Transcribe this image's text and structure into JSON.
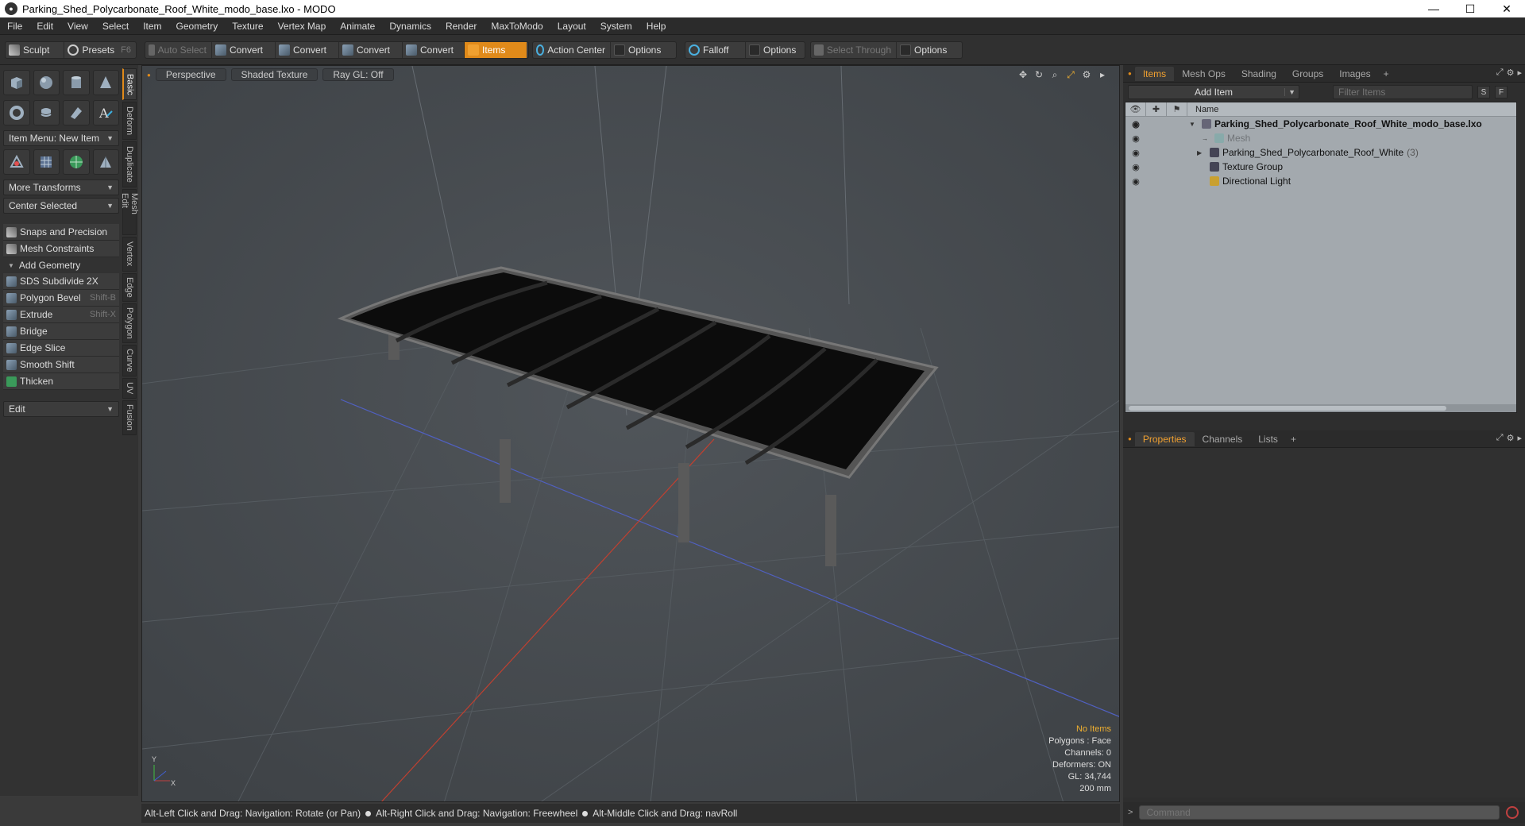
{
  "window": {
    "title": "Parking_Shed_Polycarbonate_Roof_White_modo_base.lxo - MODO",
    "minimize": "—",
    "maximize": "☐",
    "close": "✕"
  },
  "menu": [
    "File",
    "Edit",
    "View",
    "Select",
    "Item",
    "Geometry",
    "Texture",
    "Vertex Map",
    "Animate",
    "Dynamics",
    "Render",
    "MaxToModo",
    "Layout",
    "System",
    "Help"
  ],
  "toolbar": {
    "sculpt": "Sculpt",
    "presets": "Presets",
    "presets_shortcut": "F6",
    "auto_select": "Auto Select",
    "convert1": "Convert",
    "convert2": "Convert",
    "convert3": "Convert",
    "convert4": "Convert",
    "items": "Items",
    "action_center": "Action Center",
    "options1": "Options",
    "falloff": "Falloff",
    "options2": "Options",
    "select_through": "Select Through",
    "options3": "Options"
  },
  "left_panel": {
    "item_menu": "Item Menu: New Item",
    "more_transforms": "More Transforms",
    "center_selected": "Center Selected",
    "snaps": "Snaps and Precision",
    "mesh_constraints": "Mesh Constraints",
    "add_geometry": "Add Geometry",
    "tools": [
      {
        "label": "SDS Subdivide 2X",
        "shortcut": ""
      },
      {
        "label": "Polygon Bevel",
        "shortcut": "Shift-B"
      },
      {
        "label": "Extrude",
        "shortcut": "Shift-X"
      },
      {
        "label": "Bridge",
        "shortcut": ""
      },
      {
        "label": "Edge Slice",
        "shortcut": ""
      },
      {
        "label": "Smooth Shift",
        "shortcut": ""
      },
      {
        "label": "Thicken",
        "shortcut": ""
      }
    ],
    "edit": "Edit",
    "vtabs": [
      "Basic",
      "Deform",
      "Duplicate",
      "Mesh Edit",
      "Vertex",
      "Edge",
      "Polygon",
      "Curve",
      "UV",
      "Fusion"
    ]
  },
  "viewport": {
    "perspective": "Perspective",
    "shading": "Shaded Texture",
    "raygl": "Ray GL: Off",
    "info": {
      "no_items": "No Items",
      "polygons": "Polygons : Face",
      "channels": "Channels: 0",
      "deformers": "Deformers: ON",
      "gl": "GL: 34,744",
      "scale": "200 mm"
    },
    "axis_x": "X",
    "axis_y": "Y"
  },
  "statusbar": {
    "hint1": "Alt-Left Click and Drag: Navigation: Rotate (or Pan)",
    "hint2": "Alt-Right Click and Drag: Navigation: Freewheel",
    "hint3": "Alt-Middle Click and Drag: navRoll"
  },
  "right_panel": {
    "tabs": [
      "Items",
      "Mesh Ops",
      "Shading",
      "Groups",
      "Images"
    ],
    "add_item": "Add Item",
    "filter_placeholder": "Filter Items",
    "s_btn": "S",
    "f_btn": "F",
    "name_col": "Name",
    "tree": [
      {
        "label": "Parking_Shed_Polycarbonate_Roof_White_modo_base.lxo",
        "count": ""
      },
      {
        "label": "Mesh",
        "count": ""
      },
      {
        "label": "Parking_Shed_Polycarbonate_Roof_White",
        "count": "(3)"
      },
      {
        "label": "Texture Group",
        "count": ""
      },
      {
        "label": "Directional Light",
        "count": ""
      }
    ],
    "props_tabs": [
      "Properties",
      "Channels",
      "Lists"
    ],
    "command_placeholder": "Command"
  }
}
